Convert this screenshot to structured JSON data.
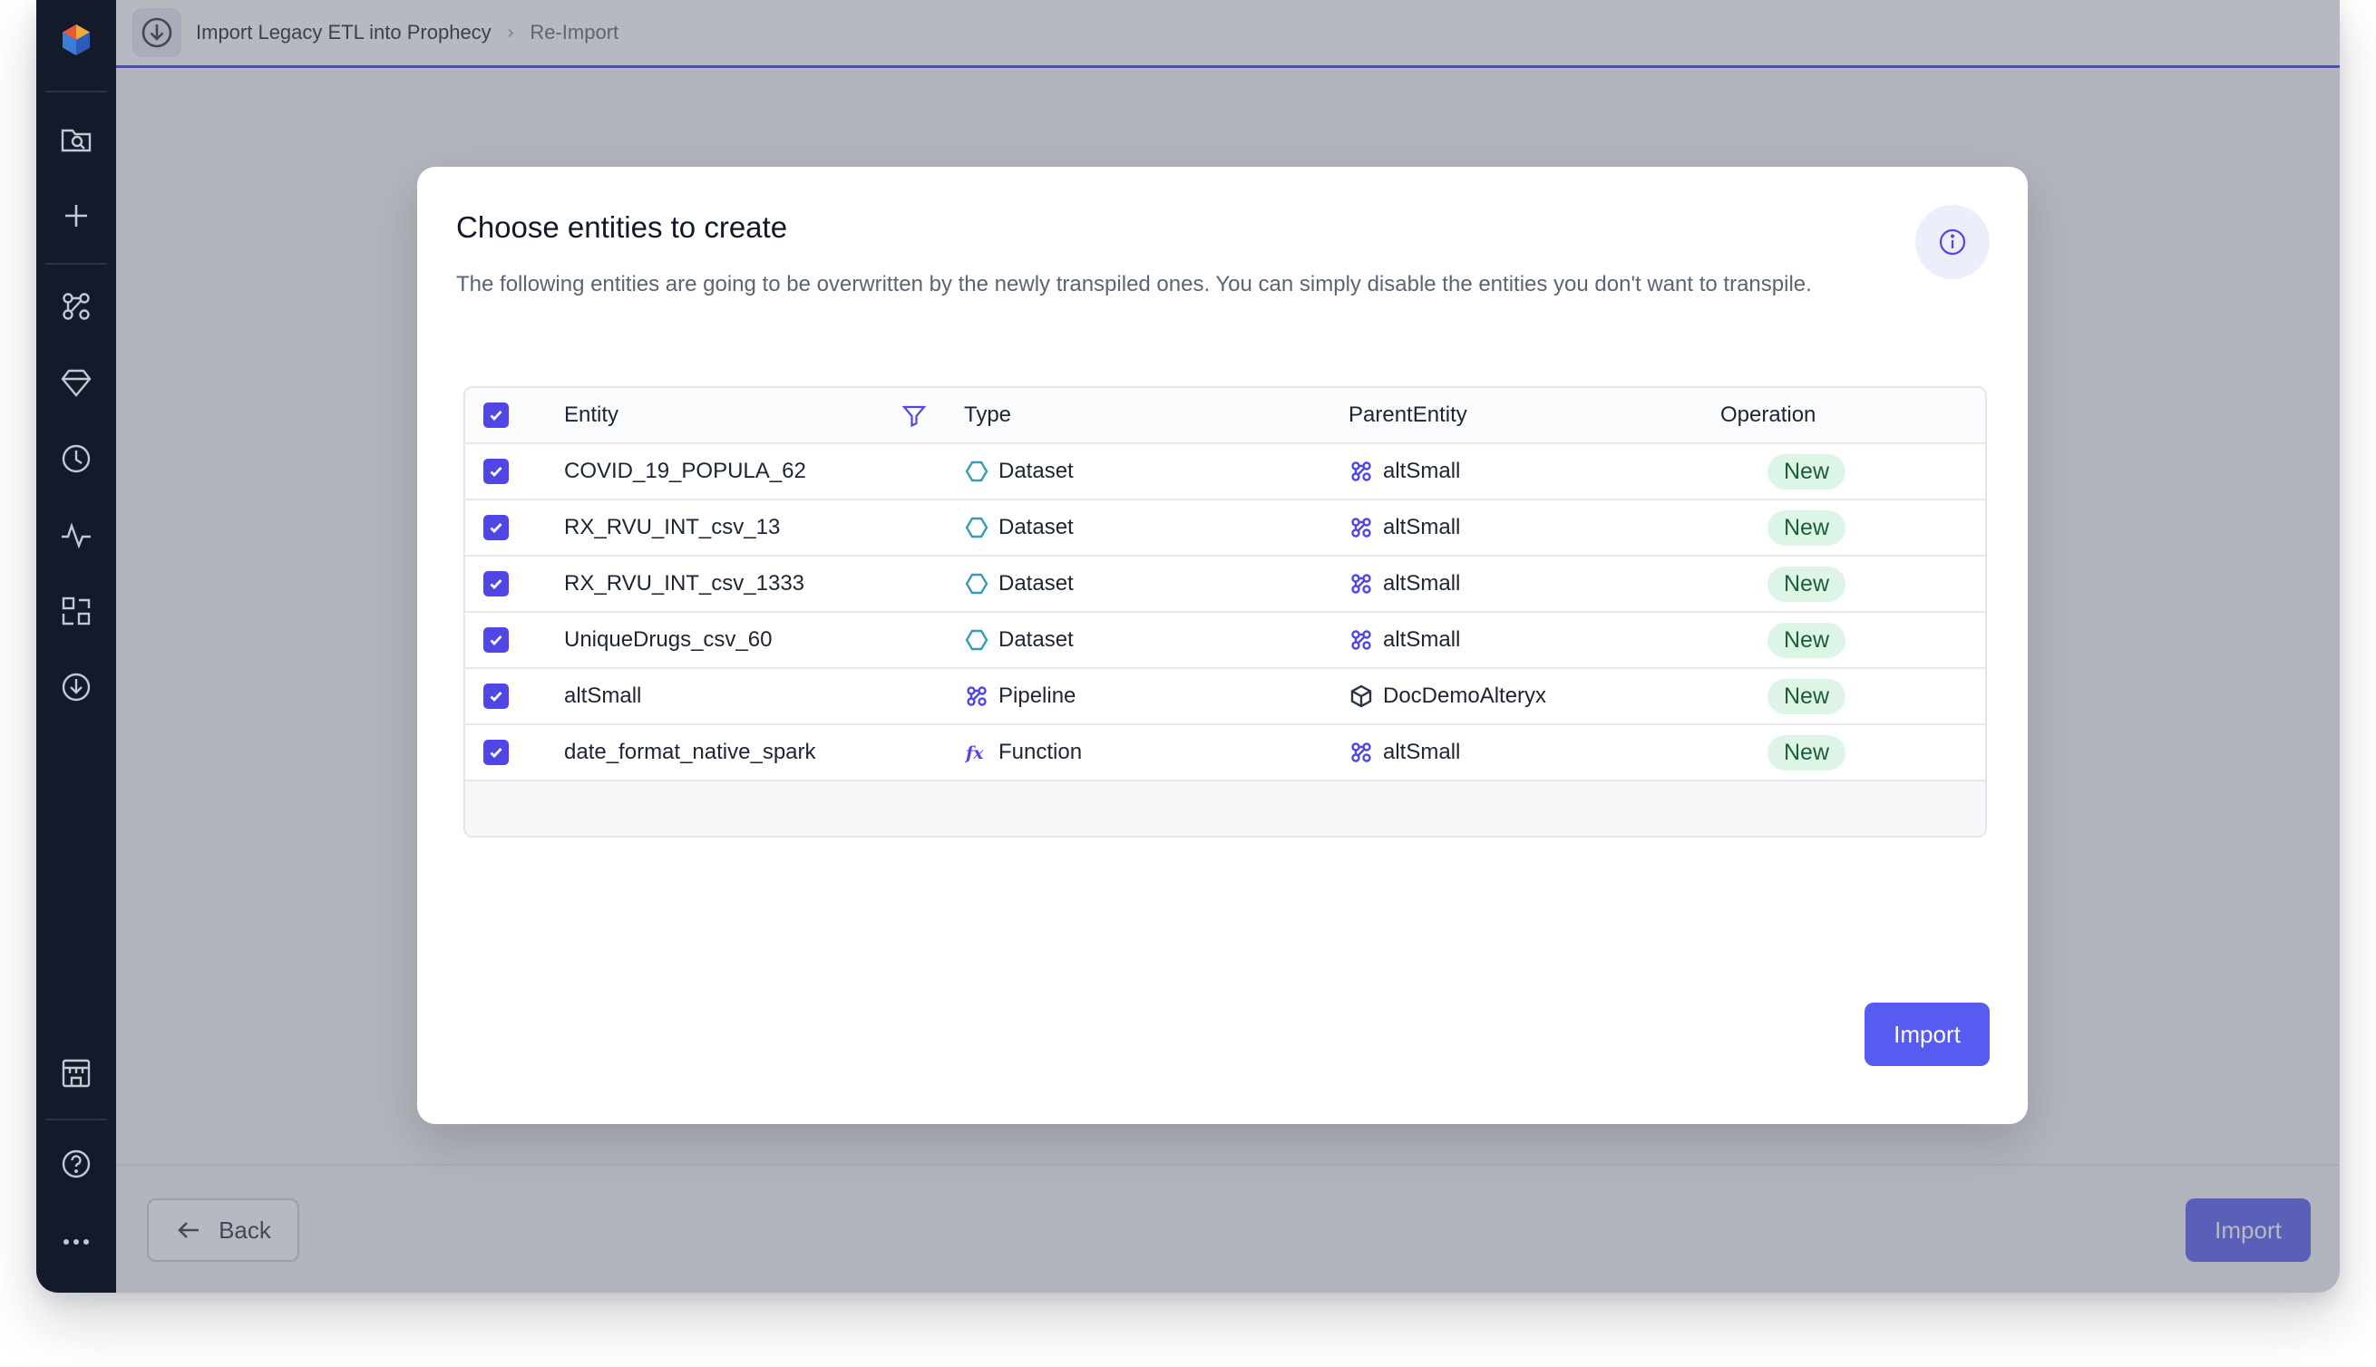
{
  "breadcrumb": {
    "root": "Import Legacy ETL into Prophecy",
    "current": "Re-Import"
  },
  "modal": {
    "title": "Choose entities to create",
    "description": "The following entities are going to be overwritten by the newly transpiled ones. You can simply disable the entities you don't want to transpile.",
    "import_label": "Import"
  },
  "table": {
    "headers": {
      "entity": "Entity",
      "type": "Type",
      "parent": "ParentEntity",
      "operation": "Operation"
    },
    "rows": [
      {
        "entity": "COVID_19_POPULA_62",
        "type": "Dataset",
        "type_icon": "dataset-icon",
        "parent": "altSmall",
        "parent_icon": "pipeline-icon",
        "operation": "New",
        "checked": true
      },
      {
        "entity": "RX_RVU_INT_csv_13",
        "type": "Dataset",
        "type_icon": "dataset-icon",
        "parent": "altSmall",
        "parent_icon": "pipeline-icon",
        "operation": "New",
        "checked": true
      },
      {
        "entity": "RX_RVU_INT_csv_1333",
        "type": "Dataset",
        "type_icon": "dataset-icon",
        "parent": "altSmall",
        "parent_icon": "pipeline-icon",
        "operation": "New",
        "checked": true
      },
      {
        "entity": "UniqueDrugs_csv_60",
        "type": "Dataset",
        "type_icon": "dataset-icon",
        "parent": "altSmall",
        "parent_icon": "pipeline-icon",
        "operation": "New",
        "checked": true
      },
      {
        "entity": "altSmall",
        "type": "Pipeline",
        "type_icon": "pipeline-icon",
        "parent": "DocDemoAlteryx",
        "parent_icon": "project-icon",
        "operation": "New",
        "checked": true
      },
      {
        "entity": "date_format_native_spark",
        "type": "Function",
        "type_icon": "function-icon",
        "parent": "altSmall",
        "parent_icon": "pipeline-icon",
        "operation": "New",
        "checked": true
      }
    ]
  },
  "footer": {
    "back_label": "Back",
    "import_label": "Import"
  },
  "colors": {
    "accent": "#575cf0",
    "sidebar": "#131a2a",
    "badge_bg": "#ddf5e6",
    "checkbox": "#4f46e5"
  }
}
